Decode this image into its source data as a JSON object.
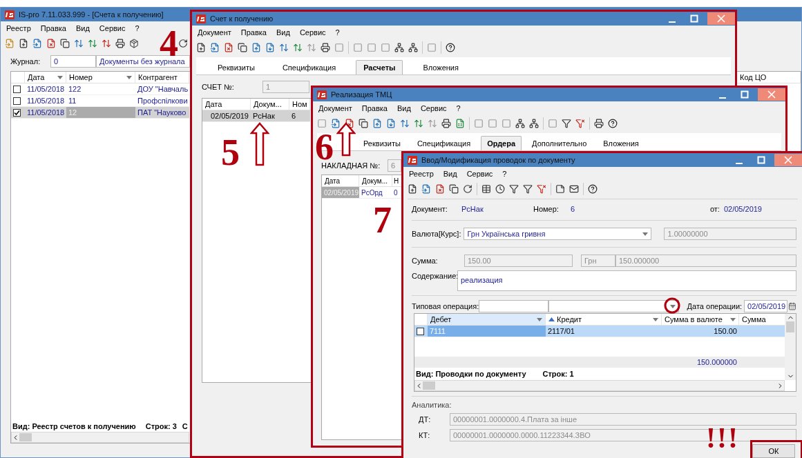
{
  "main_window": {
    "title": "IS-pro 7.11.033.999 - [Счета к получению]",
    "menu": [
      "Реестр",
      "Правка",
      "Вид",
      "Сервис",
      "?"
    ],
    "journal": {
      "label": "Журнал:",
      "code": "0",
      "name": "Документы без журнала"
    },
    "table": {
      "columns": [
        "Дата",
        "Номер",
        "Контрагент"
      ],
      "last_column": "Код ЦО",
      "rows": [
        {
          "checked": false,
          "selected": false,
          "date": "11/05/2018",
          "number": "122",
          "counterparty": "ДОУ \"Навчаль"
        },
        {
          "checked": false,
          "selected": false,
          "date": "11/05/2018",
          "number": "11",
          "counterparty": "Профспілкови"
        },
        {
          "checked": true,
          "selected": true,
          "date": "11/05/2018",
          "number": "12",
          "counterparty": "ПАТ \"Науково"
        }
      ]
    },
    "status": {
      "view": "Вид: Реестр счетов к получению",
      "rows": "Строк: 3",
      "cut": "С"
    }
  },
  "invoice_window": {
    "title": "Счет к получению",
    "menu": [
      "Документ",
      "Правка",
      "Вид",
      "Сервис",
      "?"
    ],
    "tabs": [
      {
        "label": "Реквизиты",
        "selected": false
      },
      {
        "label": "Спецификация",
        "selected": false
      },
      {
        "label": "Расчеты",
        "selected": true
      },
      {
        "label": "Вложения",
        "selected": false
      }
    ],
    "number_label": "СЧЕТ №:",
    "number": "1",
    "table": {
      "columns": [
        "Дата",
        "Докум...",
        "Ном"
      ],
      "rows": [
        {
          "date": "02/05/2019",
          "doc": "РсНак",
          "number": "6"
        }
      ]
    }
  },
  "sale_window": {
    "title": "Реализация ТМЦ",
    "menu": [
      "Документ",
      "Правка",
      "Вид",
      "Сервис",
      "?"
    ],
    "tabs": [
      {
        "label": "Реквизиты",
        "selected": false
      },
      {
        "label": "Спецификация",
        "selected": false
      },
      {
        "label": "Ордера",
        "selected": true
      },
      {
        "label": "Дополнительно",
        "selected": false
      },
      {
        "label": "Вложения",
        "selected": false
      }
    ],
    "number_label": "НАКЛАДНАЯ №:",
    "number": "6",
    "table": {
      "columns": [
        "Дата",
        "Докум...",
        "Н"
      ],
      "rows": [
        {
          "date": "02/05/2019",
          "doc": "РсОрд",
          "number": "0"
        }
      ]
    }
  },
  "entry_window": {
    "title": "Ввод/Модификация проводок по документу",
    "menu": [
      "Реестр",
      "Вид",
      "Сервис",
      "?"
    ],
    "document_label": "Документ:",
    "document": "РсНак",
    "number_label": "Номер:",
    "number": "6",
    "date_label": "от:",
    "date": "02/05/2019",
    "currency_label": "Валюта[Курс]:",
    "currency": "Грн Українська гривня",
    "rate": "1.00000000",
    "sum_label": "Сумма:",
    "sum": "150.00",
    "sum_currency": "Грн",
    "sum_uah": "150.000000",
    "content_label": "Содержание:",
    "content": "реализация",
    "operation_label": "Типовая операция:",
    "operation_date_label": "Дата операции:",
    "operation_date": "02/05/2019",
    "grid": {
      "columns": [
        "Дебет",
        "Кредит",
        "Сумма в валюте",
        "Сумма"
      ],
      "rows": [
        {
          "checked": false,
          "selected": true,
          "debit": "7111",
          "credit": "2117/01",
          "amount": "150.00"
        }
      ],
      "total": "150.000000",
      "view": "Вид: Проводки по документу",
      "rows_count": "Строк: 1"
    },
    "analytics_label": "Аналитика:",
    "dt_label": "ДТ:",
    "dt": "00000001.0000000.4.Плата за інше",
    "kt_label": "КТ:",
    "kt": "00000001.0000000.0000.11223344.ЗВО",
    "ok": "ОК"
  },
  "annotations": {
    "steps": [
      "4",
      "5",
      "6",
      "7"
    ],
    "exclamation": "!!!"
  }
}
